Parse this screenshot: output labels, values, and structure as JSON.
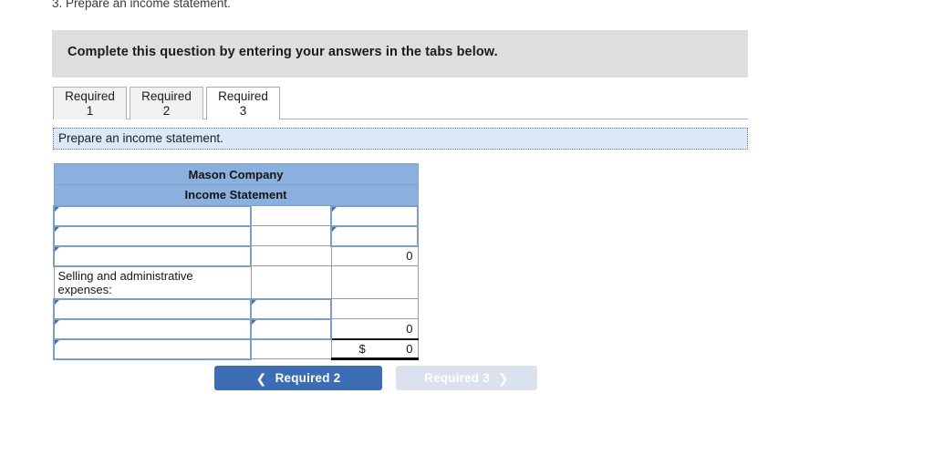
{
  "question_line": "3. Prepare an income statement.",
  "banner": {
    "text": "Complete this question by entering your answers in the tabs below."
  },
  "tabs": [
    {
      "line1": "Required",
      "line2": "1",
      "active": false
    },
    {
      "line1": "Required",
      "line2": "2",
      "active": false
    },
    {
      "line1": "Required",
      "line2": "3",
      "active": true
    }
  ],
  "subbar": {
    "text": "Prepare an income statement."
  },
  "sheet": {
    "title_line1": "Mason Company",
    "title_line2": "Income Statement",
    "rows": [
      {
        "label": "",
        "col2": "",
        "col3": ""
      },
      {
        "label": "",
        "col2": "",
        "col3": ""
      },
      {
        "label": "",
        "col2": "",
        "col3": "0"
      },
      {
        "label": "Selling and administrative expenses:",
        "col2": "",
        "col3": ""
      },
      {
        "label": "",
        "col2": "",
        "col3": ""
      },
      {
        "label": "",
        "col2": "",
        "col3": "0"
      },
      {
        "label": "",
        "col2": "",
        "col3": "0",
        "currency": "$"
      }
    ]
  },
  "nav": {
    "prev_label": "Required 2",
    "prev_chevron": "chevron-left",
    "next_label": "Required 3",
    "next_chevron": "chevron-right"
  },
  "colors": {
    "header_blue": "#8cb0dd",
    "banner_gray": "#dedede",
    "subbar_blue": "#dceaf7",
    "button_active": "#3c6cb4",
    "button_disabled": "#dae2f0",
    "input_border": "#7d9fc6"
  }
}
